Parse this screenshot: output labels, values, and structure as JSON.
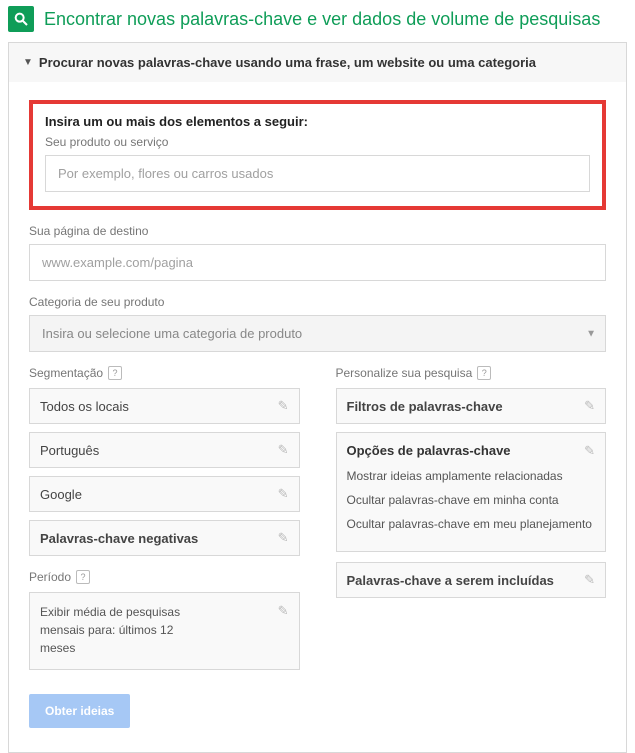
{
  "header": {
    "title": "Encontrar novas palavras-chave e ver dados de volume de pesquisas"
  },
  "panel": {
    "title": "Procurar novas palavras-chave usando uma frase, um website ou uma categoria"
  },
  "highlight": {
    "title": "Insira um ou mais dos elementos a seguir:",
    "product_label": "Seu produto ou serviço",
    "product_placeholder": "Por exemplo, flores ou carros usados"
  },
  "landing": {
    "label": "Sua página de destino",
    "placeholder": "www.example.com/pagina"
  },
  "category": {
    "label": "Categoria de seu produto",
    "placeholder": "Insira ou selecione uma categoria de produto"
  },
  "targeting": {
    "label": "Segmentação",
    "items": [
      {
        "label": "Todos os locais",
        "bold": false
      },
      {
        "label": "Português",
        "bold": false
      },
      {
        "label": "Google",
        "bold": false
      },
      {
        "label": "Palavras-chave negativas",
        "bold": true
      }
    ]
  },
  "period": {
    "label": "Período",
    "text": "Exibir média de pesquisas mensais para: últimos 12 meses"
  },
  "customize": {
    "label": "Personalize sua pesquisa",
    "filters_label": "Filtros de palavras-chave",
    "options_label": "Opções de palavras-chave",
    "options_items": [
      "Mostrar ideias amplamente relacionadas",
      "Ocultar palavras-chave em minha conta",
      "Ocultar palavras-chave em meu planejamento"
    ],
    "include_label": "Palavras-chave a serem incluídas"
  },
  "submit_label": "Obter ideias"
}
